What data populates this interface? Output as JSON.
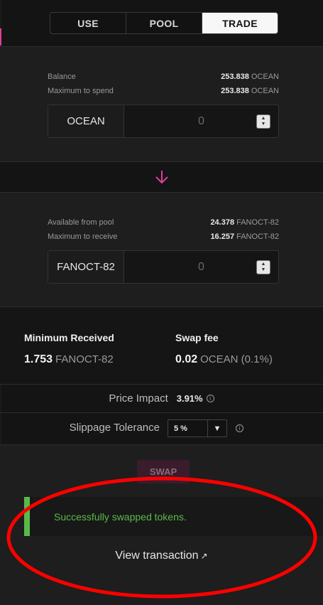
{
  "tabs": [
    {
      "label": "USE"
    },
    {
      "label": "POOL"
    },
    {
      "label": "TRADE"
    }
  ],
  "active_tab": "TRADE",
  "from": {
    "balance_label": "Balance",
    "balance_value": "253.838",
    "balance_unit": "OCEAN",
    "max_label": "Maximum to spend",
    "max_value": "253.838",
    "max_unit": "OCEAN",
    "token": "OCEAN",
    "amount": "0"
  },
  "to": {
    "available_label": "Available from pool",
    "available_value": "24.378",
    "available_unit": "FANOCT-82",
    "max_label": "Maximum to receive",
    "max_value": "16.257",
    "max_unit": "FANOCT-82",
    "token": "FANOCT-82",
    "amount": "0"
  },
  "summary": {
    "min_received_label": "Minimum Received",
    "min_received_value": "1.753",
    "min_received_unit": "FANOCT-82",
    "swap_fee_label": "Swap fee",
    "swap_fee_value": "0.02",
    "swap_fee_unit": "OCEAN (0.1%)"
  },
  "price_impact": {
    "label": "Price Impact",
    "value": "3.91%"
  },
  "slippage": {
    "label": "Slippage Tolerance",
    "value": "5 %"
  },
  "swap_button": "SWAP",
  "alert": {
    "message": "Successfully swapped tokens.",
    "color": "#5aba48"
  },
  "view_transaction": "View transaction",
  "icons": {
    "arrow": "arrow-down-icon",
    "info": "info-icon",
    "external": "external-link-icon"
  },
  "colors": {
    "accent": "#e0409a",
    "success": "#5aba48",
    "annotation": "#ff0000"
  }
}
